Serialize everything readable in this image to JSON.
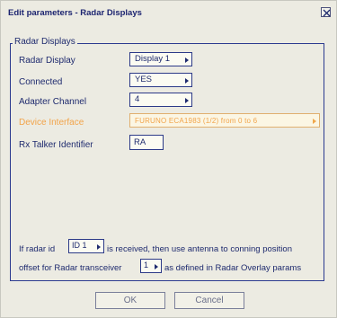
{
  "window": {
    "title": "Edit parameters - Radar Displays"
  },
  "group": {
    "legend": "Radar Displays"
  },
  "fields": {
    "radar_display": {
      "label": "Radar Display",
      "value": "Display 1"
    },
    "connected": {
      "label": "Connected",
      "value": "YES"
    },
    "adapter_channel": {
      "label": "Adapter Channel",
      "value": "4"
    },
    "device_interface": {
      "label": "Device Interface",
      "value": "FURUNO ECA1983 (1/2) from 0 to 6"
    },
    "rx_talker": {
      "label": "Rx Talker Identifier",
      "value": "RA"
    }
  },
  "bottom": {
    "line1_prefix": "If radar id",
    "radar_id_value": "ID 1",
    "line1_suffix": "is received, then use antenna to conning position",
    "line2_prefix": "offset for Radar transceiver",
    "transceiver_value": "1",
    "line2_suffix": "as defined in Radar Overlay params"
  },
  "buttons": {
    "ok": "OK",
    "cancel": "Cancel"
  },
  "icons": {
    "close": "close-icon",
    "dropdown_arrow": "triangle-right-icon"
  },
  "colors": {
    "text": "#1e2a6e",
    "border": "#2b3a8f",
    "disabled_text": "#f2a44a",
    "background": "#ecebe2"
  }
}
